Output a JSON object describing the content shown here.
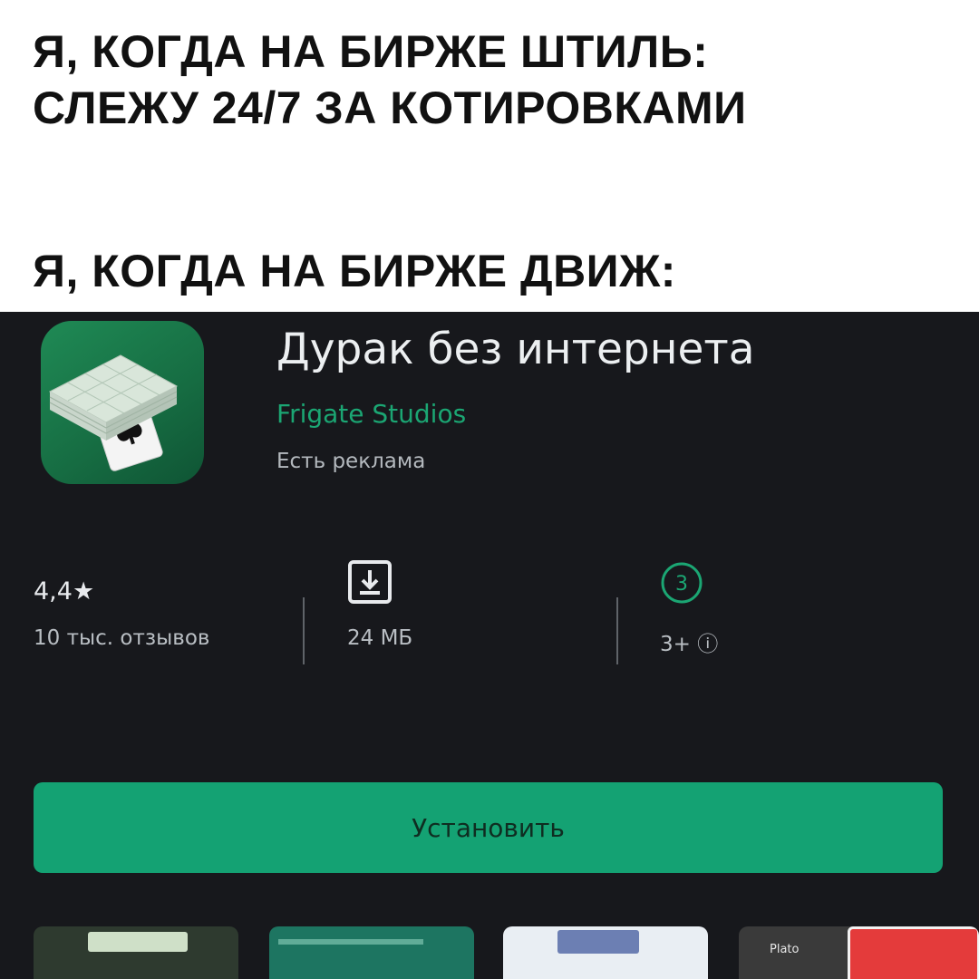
{
  "captions": {
    "calm": "Я, КОГДА НА БИРЖЕ ШТИЛЬ: СЛЕЖУ 24/7 ЗА КОТИРОВКАМИ",
    "calm_line1": "Я, КОГДА НА БИРЖЕ ШТИЛЬ:",
    "calm_line2": "СЛЕЖУ 24/7 ЗА КОТИРОВКАМИ",
    "action": "Я, КОГДА НА БИРЖЕ ДВИЖ:"
  },
  "app": {
    "title": "Дурак без интернета",
    "developer": "Frigate Studios",
    "ads_note": "Есть реклама",
    "icon": "card-deck-icon"
  },
  "stats": {
    "rating": "4,4★",
    "rating_value": 4.4,
    "reviews": "10 тыс. отзывов",
    "size_icon": "download-icon",
    "size": "24 МБ",
    "age_badge": "3",
    "age": "3+ ⓘ"
  },
  "install": {
    "label": "Установить"
  },
  "screenshots": [
    {
      "name": "screenshot-1",
      "label": ""
    },
    {
      "name": "screenshot-2",
      "label": ""
    },
    {
      "name": "screenshot-3",
      "label": ""
    },
    {
      "name": "screenshot-4",
      "label": "Plato"
    }
  ],
  "colors": {
    "background": "#17181c",
    "accent": "#14a273",
    "developer_link": "#1ba673",
    "icon_bg": "#1f8a55"
  }
}
